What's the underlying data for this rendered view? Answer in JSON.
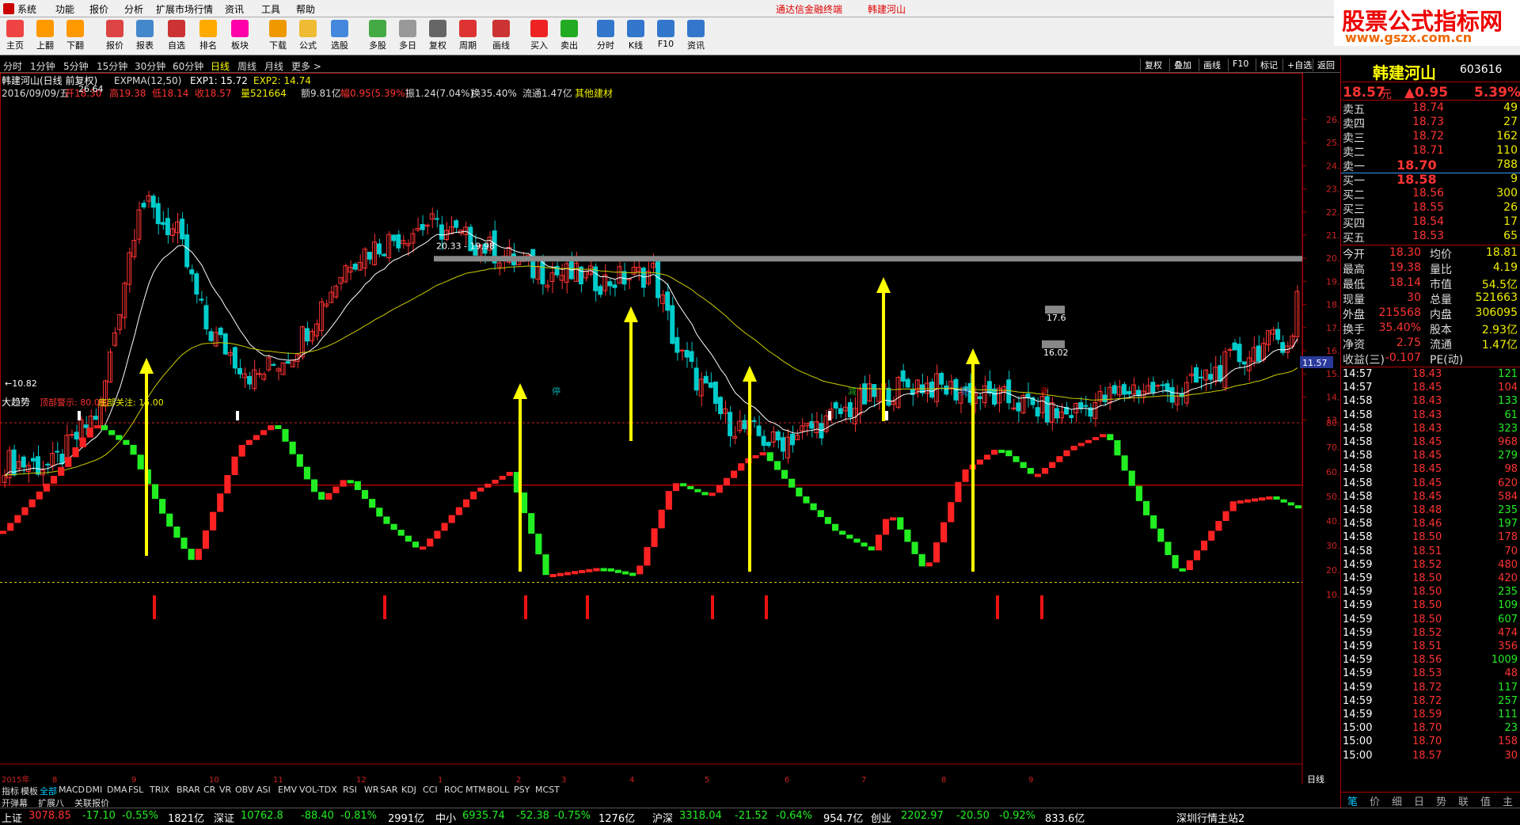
{
  "menu": {
    "items": [
      "系统",
      "功能",
      "报价",
      "分析",
      "扩展市场行情",
      "资讯",
      "工具",
      "帮助"
    ],
    "title1": "通达信金融终端",
    "title2": "韩建河山"
  },
  "brand": {
    "line1": "股票公式指标网",
    "line2": "www.gszx.com.cn"
  },
  "toolbar": [
    {
      "label": "主页",
      "color": "#e44"
    },
    {
      "label": "上翻",
      "color": "#f90"
    },
    {
      "label": "下翻",
      "color": "#f90"
    },
    {
      "label": "报价",
      "color": "#d44"
    },
    {
      "label": "报表",
      "color": "#48c"
    },
    {
      "label": "自选",
      "color": "#c33"
    },
    {
      "label": "排名",
      "color": "#fa0"
    },
    {
      "label": "板块",
      "color": "#f0a"
    },
    {
      "label": "下载",
      "color": "#e90"
    },
    {
      "label": "公式",
      "color": "#eb3"
    },
    {
      "label": "选股",
      "color": "#48d"
    },
    {
      "label": "多股",
      "color": "#4a4"
    },
    {
      "label": "多日",
      "color": "#999"
    },
    {
      "label": "复权",
      "color": "#666"
    },
    {
      "label": "周期",
      "color": "#d33"
    },
    {
      "label": "画线",
      "color": "#c33"
    },
    {
      "label": "买入",
      "color": "#e22"
    },
    {
      "label": "卖出",
      "color": "#2a2"
    },
    {
      "label": "分时",
      "color": "#37c"
    },
    {
      "label": "K线",
      "color": "#37c"
    },
    {
      "label": "F10",
      "color": "#37c"
    },
    {
      "label": "资讯",
      "color": "#37c"
    }
  ],
  "periods": [
    "分时",
    "1分钟",
    "5分钟",
    "15分钟",
    "30分钟",
    "60分钟",
    "日线",
    "周线",
    "月线",
    "更多 >"
  ],
  "period_active": "日线",
  "right_tools": [
    "复权",
    "叠加",
    "画线",
    "F10",
    "标记",
    "+自选",
    "返回"
  ],
  "info": {
    "line1a": "韩建河山(日线 前复权)",
    "line1b": "EXPMA(12,50)",
    "exp1": "EXP1: 15.72",
    "exp2": "EXP2: 14.74",
    "date": "2016/09/09/五",
    "open": "开18.30",
    "high": "高19.38",
    "low": "低18.14",
    "close": "收18.57",
    "vol": "量521664",
    "amt": "额9.81亿",
    "chg": "幅0.95(5.39%)",
    "amp": "振1.24(7.04%)",
    "turn": "换35.40%",
    "circ": "流通1.47亿",
    "ind": "其他建材"
  },
  "price_axis": [
    "26.00",
    "25.00",
    "24.00",
    "23.00",
    "22.00",
    "21.00",
    "20.00",
    "19.00",
    "18.00",
    "17.00",
    "16.00",
    "15.00",
    "14.00",
    "13.00"
  ],
  "marks": {
    "high": "26.64",
    "low": "10.82",
    "range": "20.33 - 19.98",
    "r1": "17.6",
    "r2": "16.02",
    "cur": "11.57"
  },
  "tags": [
    {
      "t": "停",
      "c": "#0aa"
    },
    {
      "t": "减",
      "c": "#2a2"
    },
    {
      "t": "↓",
      "c": "#d00"
    },
    {
      "t": "财",
      "c": "#37c"
    },
    {
      "t": "涨",
      "c": "#d00"
    }
  ],
  "ind": {
    "name": "大趋势",
    "top": "顶部警示: 80.00",
    "bottom": "底部关注: 15.00",
    "axis": [
      "80.00",
      "70.00",
      "60.00",
      "50.00",
      "40.00",
      "30.00",
      "20.00",
      "10.00"
    ]
  },
  "xaxis": {
    "year": "2015年",
    "months": [
      "8",
      "9",
      "10",
      "11",
      "12",
      "1",
      "2",
      "3",
      "4",
      "5",
      "6",
      "7",
      "8",
      "9"
    ],
    "dayline": "日线"
  },
  "tabs1": [
    "指标",
    "模板",
    "全部",
    "MACD",
    "DMI",
    "DMA",
    "FSL",
    "TRIX",
    "BRAR",
    "CR",
    "VR",
    "OBV",
    "ASI",
    "EMV",
    "VOL-TDX",
    "RSI",
    "WR",
    "SAR",
    "KDJ",
    "CCI",
    "ROC",
    "MTM",
    "BOLL",
    "PSY",
    "MCST"
  ],
  "tabs2": [
    "开弹幕",
    "扩展八",
    "关联报价"
  ],
  "chart_data": {
    "type": "candlestick",
    "series": [
      {
        "name": "EXP1",
        "value": 15.72
      },
      {
        "name": "EXP2",
        "value": 14.74
      }
    ],
    "ind_levels": {
      "top": 80,
      "bottom": 15
    }
  },
  "side": {
    "name": "韩建河山",
    "code": "603616",
    "price": "18.57",
    "unit": "元",
    "chg": "▲0.95",
    "pct": "5.39%",
    "asks": [
      [
        "卖五",
        "18.74",
        "49"
      ],
      [
        "卖四",
        "18.73",
        "27"
      ],
      [
        "卖三",
        "18.72",
        "162"
      ],
      [
        "卖二",
        "18.71",
        "110"
      ],
      [
        "卖一",
        "18.70",
        "788"
      ]
    ],
    "bids": [
      [
        "买一",
        "18.58",
        "9"
      ],
      [
        "买二",
        "18.56",
        "300"
      ],
      [
        "买三",
        "18.55",
        "26"
      ],
      [
        "买四",
        "18.54",
        "17"
      ],
      [
        "买五",
        "18.53",
        "65"
      ]
    ],
    "stats": [
      [
        "今开",
        "18.30",
        "均价",
        "18.81"
      ],
      [
        "最高",
        "19.38",
        "量比",
        "4.19"
      ],
      [
        "最低",
        "18.14",
        "市值",
        "54.5亿"
      ],
      [
        "现量",
        "30",
        "总量",
        "521663"
      ],
      [
        "外盘",
        "215568",
        "内盘",
        "306095"
      ],
      [
        "换手",
        "35.40%",
        "股本",
        "2.93亿"
      ],
      [
        "净资",
        "2.75",
        "流通",
        "1.47亿"
      ],
      [
        "收益(三)",
        "-0.107",
        "PE(动)",
        ""
      ]
    ],
    "ticks": [
      [
        "14:57",
        "18.43",
        "121"
      ],
      [
        "14:57",
        "18.45",
        "104"
      ],
      [
        "14:58",
        "18.43",
        "133"
      ],
      [
        "14:58",
        "18.43",
        "61"
      ],
      [
        "14:58",
        "18.43",
        "323"
      ],
      [
        "14:58",
        "18.45",
        "968"
      ],
      [
        "14:58",
        "18.45",
        "279"
      ],
      [
        "14:58",
        "18.45",
        "98"
      ],
      [
        "14:58",
        "18.45",
        "620"
      ],
      [
        "14:58",
        "18.45",
        "584"
      ],
      [
        "14:58",
        "18.48",
        "235"
      ],
      [
        "14:58",
        "18.46",
        "197"
      ],
      [
        "14:58",
        "18.50",
        "178"
      ],
      [
        "14:58",
        "18.51",
        "70"
      ],
      [
        "14:59",
        "18.52",
        "480"
      ],
      [
        "14:59",
        "18.50",
        "420"
      ],
      [
        "14:59",
        "18.50",
        "235"
      ],
      [
        "14:59",
        "18.50",
        "109"
      ],
      [
        "14:59",
        "18.50",
        "607"
      ],
      [
        "14:59",
        "18.52",
        "474"
      ],
      [
        "14:59",
        "18.51",
        "356"
      ],
      [
        "14:59",
        "18.56",
        "1009"
      ],
      [
        "14:59",
        "18.53",
        "48"
      ],
      [
        "14:59",
        "18.72",
        "117"
      ],
      [
        "14:59",
        "18.72",
        "257"
      ],
      [
        "14:59",
        "18.59",
        "111"
      ],
      [
        "15:00",
        "18.70",
        "23"
      ],
      [
        "15:00",
        "18.70",
        "158"
      ],
      [
        "15:00",
        "18.57",
        "30"
      ]
    ],
    "minitabs": [
      "笔",
      "价",
      "细",
      "日",
      "势",
      "联",
      "值",
      "主"
    ]
  },
  "status": {
    "sh": "上证",
    "sh_v": "3078.85",
    "sh_c": "-17.10",
    "sh_p": "-0.55%",
    "sh_a": "1821亿",
    "sz": "深证",
    "sz_v": "10762.8",
    "sz_c": "-88.40",
    "sz_p": "-0.81%",
    "sz_a": "2991亿",
    "zx": "中小",
    "zx_v": "6935.74",
    "zx_c": "-52.38",
    "zx_p": "-0.75%",
    "zx_a": "1276亿",
    "hs": "沪深",
    "hs_v": "3318.04",
    "hs_c": "-21.52",
    "hs_p": "-0.64%",
    "hs_a": "954.7亿",
    "cy": "创业",
    "cy_v": "2202.97",
    "cy_c": "-20.50",
    "cy_p": "-0.92%",
    "cy_a": "833.6亿",
    "srv": "深圳行情主站2"
  }
}
